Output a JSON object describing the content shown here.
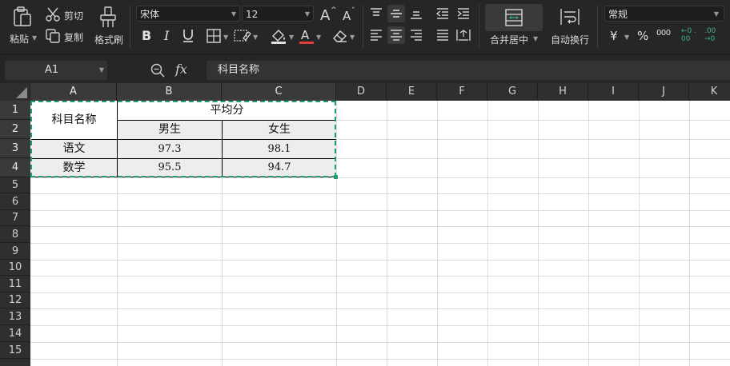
{
  "toolbar": {
    "paste_label": "粘贴",
    "cut_label": "剪切",
    "copy_label": "复制",
    "format_painter_label": "格式刷",
    "font_name": "宋体",
    "font_size": "12",
    "merge_label": "合并居中",
    "wrap_label": "自动换行",
    "number_format": "常规",
    "currency_symbol": "¥",
    "percent_symbol": "%",
    "thousands_symbol": "000",
    "increase_decimal": "←0 .00",
    "decrease_decimal": ".00 →0",
    "font_color": "#e23b3b",
    "fill_color": "#e0e0e0"
  },
  "formula_bar": {
    "cell_ref": "A1",
    "fx_label": "fx",
    "content": "科目名称"
  },
  "sheet": {
    "columns": [
      "A",
      "B",
      "C",
      "D",
      "E",
      "F",
      "G",
      "H",
      "I",
      "J",
      "K"
    ],
    "rows": [
      "1",
      "2",
      "3",
      "4",
      "5",
      "6",
      "7",
      "8",
      "9",
      "10",
      "11",
      "12",
      "13",
      "14",
      "15"
    ],
    "cells": {
      "header_subject": "科目名称",
      "header_avg": "平均分",
      "header_male": "男生",
      "header_female": "女生",
      "row1_subject": "语文",
      "row1_male": "97.3",
      "row1_female": "98.1",
      "row2_subject": "数学",
      "row2_male": "95.5",
      "row2_female": "94.7"
    },
    "selection_color": "#1f9d74"
  }
}
